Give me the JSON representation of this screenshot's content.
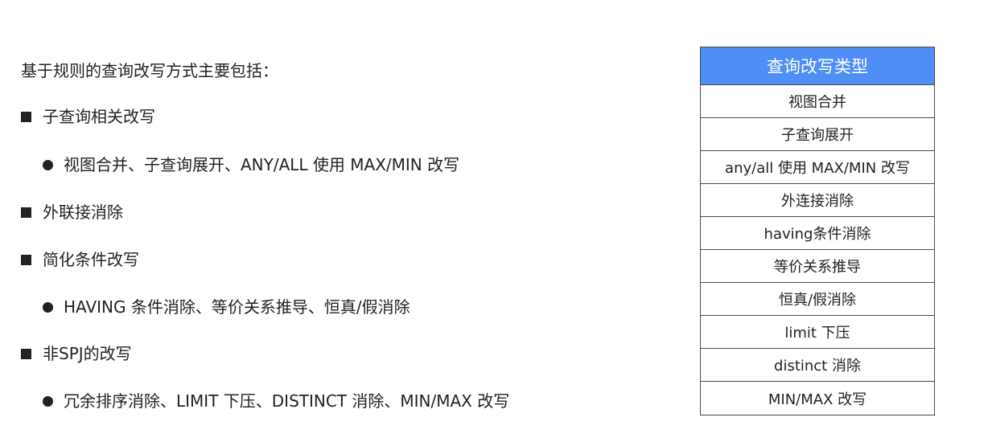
{
  "intro": "基于规则的查询改写方式主要包括：",
  "outline": [
    {
      "text": "子查询相关改写"
    },
    {
      "text": "视图合并、子查询展开、ANY/ALL 使用 MAX/MIN 改写"
    },
    {
      "text": "外联接消除"
    },
    {
      "text": "简化条件改写"
    },
    {
      "text": "HAVING 条件消除、等价关系推导、恒真/假消除"
    },
    {
      "text": "非SPJ的改写"
    },
    {
      "text": "冗余排序消除、LIMIT 下压、DISTINCT 消除、MIN/MAX 改写"
    }
  ],
  "table": {
    "header": "查询改写类型",
    "header_color": "#4f8ff5",
    "rows": [
      "视图合并",
      "子查询展开",
      "any/all 使用 MAX/MIN 改写",
      "外连接消除",
      "having条件消除",
      "等价关系推导",
      "恒真/假消除",
      "limit 下压",
      "distinct 消除",
      "MIN/MAX 改写"
    ]
  }
}
